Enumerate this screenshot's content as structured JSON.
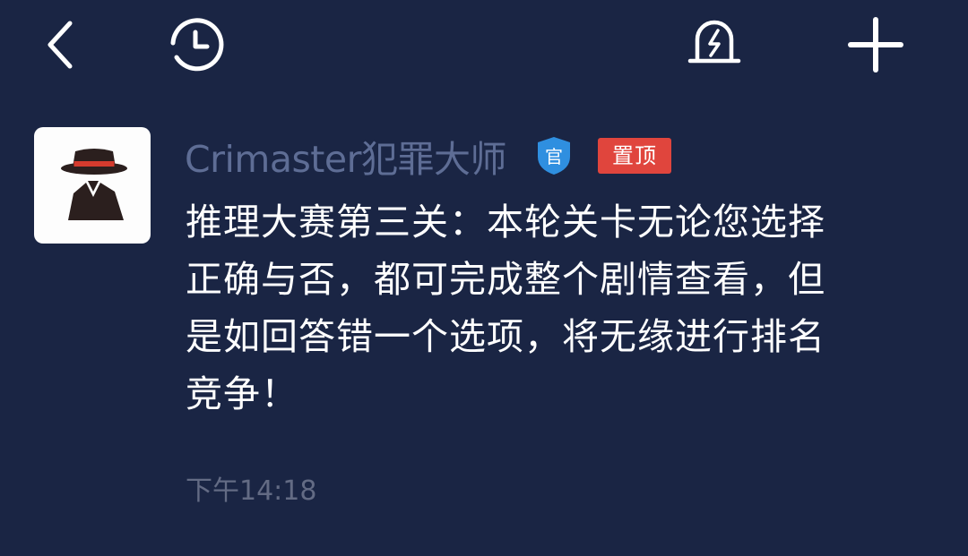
{
  "topbar": {
    "icons": {
      "back": "chevron-left-icon",
      "history": "clock-icon",
      "alarm": "alarm-bell-icon",
      "add": "plus-icon"
    }
  },
  "message": {
    "sender_name": "Crimaster犯罪大师",
    "official_badge": "官",
    "pinned_label": "置顶",
    "text": "推理大赛第三关：本轮关卡无论您选择正确与否，都可完成整个剧情查看，但是如回答错一个选项，将无缘进行排名竞争！",
    "timestamp": "下午14:18"
  },
  "colors": {
    "background": "#1a2544",
    "sender_name": "#5e6d95",
    "pinned_badge": "#e0453d",
    "official_badge": "#2f8fe0",
    "timestamp": "#636b84"
  }
}
